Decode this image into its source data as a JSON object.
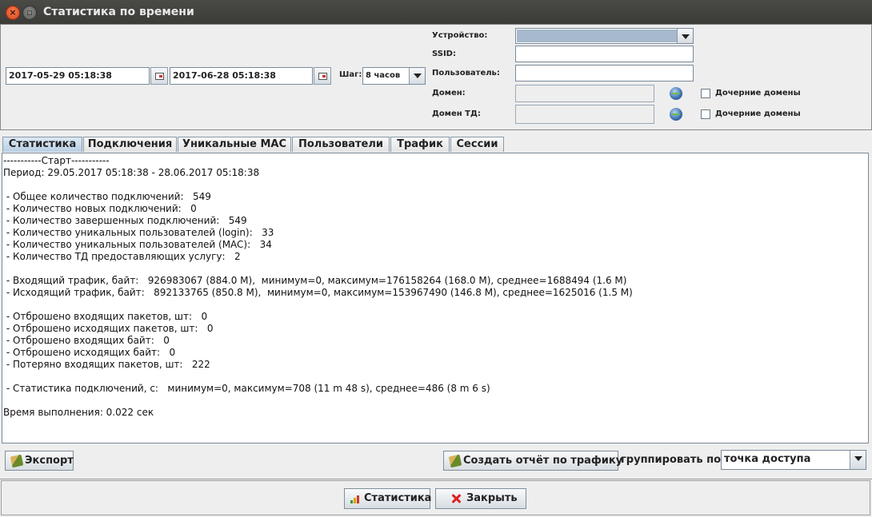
{
  "window": {
    "title": "Статистика по времени",
    "close_icon": "close-icon",
    "minimize_icon": "minimize-icon"
  },
  "filters": {
    "date_from": "2017-05-29 05:18:38",
    "date_to": "2017-06-28 05:18:38",
    "step_label": "Шаг:",
    "step_value": "8 часов",
    "device_label": "Устройство:",
    "device_value": "",
    "ssid_label": "SSID:",
    "ssid_value": "",
    "user_label": "Пользователь:",
    "user_value": "",
    "domain_label": "Домен:",
    "domain_value": "",
    "domain_td_label": "Домен ТД:",
    "domain_td_value": "",
    "child_domains_label": "Дочерние домены",
    "child_domains_td_label": "Дочерние домены",
    "child_domains_checked": false,
    "child_domains_td_checked": false,
    "device_accent": "#a7b9cc"
  },
  "tabs": [
    "Статистика",
    "Подключения",
    "Уникальные МАС",
    "Пользователи",
    "Трафик",
    "Сессии"
  ],
  "active_tab": 0,
  "stats_lines": [
    "-----------Старт-----------",
    "Период: 29.05.2017 05:18:38 - 28.06.2017 05:18:38",
    "",
    " - Общее количество подключений:   549",
    " - Количество новых подключений:   0",
    " - Количество завершенных подключений:   549",
    " - Количество уникальных пользователей (login):   33",
    " - Количество уникальных пользователей (MAC):   34",
    " - Количество ТД предоставляющих услугу:   2",
    "",
    " - Входящий трафик, байт:   926983067 (884.0 M),  минимум=0, максимум=176158264 (168.0 M), среднее=1688494 (1.6 M)",
    " - Исходящий трафик, байт:   892133765 (850.8 M),  минимум=0, максимум=153967490 (146.8 M), среднее=1625016 (1.5 M)",
    "",
    " - Отброшено входящих пакетов, шт:   0",
    " - Отброшено исходящих пакетов, шт:   0",
    " - Отброшено входящих байт:   0",
    " - Отброшено исходящих байт:   0",
    " - Потеряно входящих пакетов, шт:   222",
    "",
    " - Статистика подключений, с:   минимум=0, максимум=708 (11 m 48 s), среднее=486 (8 m 6 s)",
    "",
    "Время выполнения: 0.022 сек"
  ],
  "actions": {
    "export_label": "Экспорт",
    "create_report_label": "Создать отчёт по трафику",
    "group_by_label": "группировать по:",
    "group_by_value": "точка доступа"
  },
  "footer": {
    "statistics_label": "Статистика",
    "close_label": "Закрыть"
  }
}
